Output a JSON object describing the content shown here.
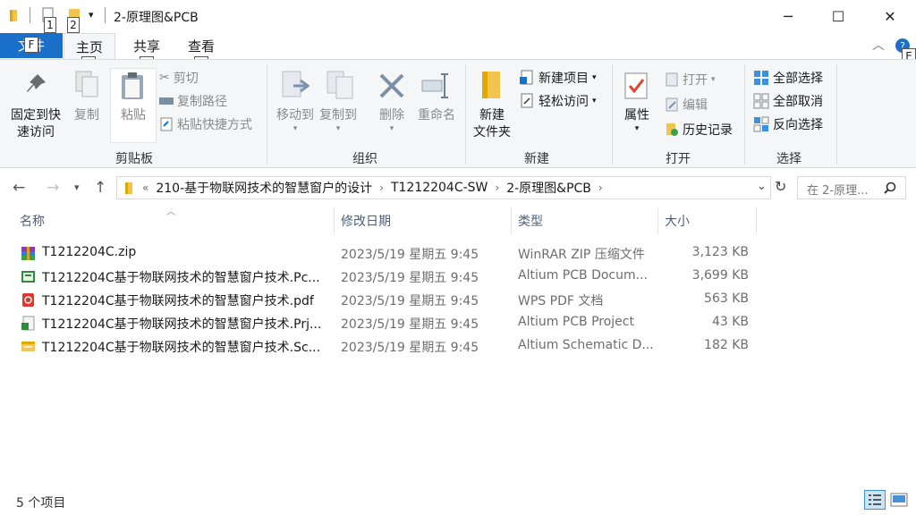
{
  "window": {
    "title": "2-原理图&PCB",
    "qat_badges": [
      "1",
      "2"
    ],
    "controls": {
      "minimize": "─",
      "maximize": "☐",
      "close": "✕"
    }
  },
  "ribbon_tabs": {
    "file": "文件",
    "file_key": "F",
    "home": "主页",
    "home_key": "H",
    "share": "共享",
    "share_key": "S",
    "view": "查看",
    "view_key": "V",
    "help_key": "E"
  },
  "clipboard": {
    "label": "剪贴板",
    "pin": "固定到快速访问",
    "pin_line1": "固定到快",
    "pin_line2": "速访问",
    "copy": "复制",
    "paste": "粘贴",
    "cut": "剪切",
    "copy_path": "复制路径",
    "paste_shortcut": "粘贴快捷方式"
  },
  "organize": {
    "label": "组织",
    "move_to": "移动到",
    "copy_to": "复制到",
    "delete": "删除",
    "rename": "重命名"
  },
  "new": {
    "label": "新建",
    "new_item": "新建项目",
    "easy_access": "轻松访问",
    "new_folder_line1": "新建",
    "new_folder_line2": "文件夹"
  },
  "open": {
    "label": "打开",
    "properties": "属性",
    "open": "打开",
    "edit": "编辑",
    "history": "历史记录"
  },
  "select": {
    "label": "选择",
    "select_all": "全部选择",
    "select_none": "全部取消",
    "invert": "反向选择"
  },
  "address": {
    "overflow": "«",
    "crumbs": [
      "210-基于物联网技术的智慧窗户的设计",
      "T1212204C-SW",
      "2-原理图&PCB"
    ],
    "search_placeholder": "在 2-原理..."
  },
  "columns": {
    "name": "名称",
    "date": "修改日期",
    "type": "类型",
    "size": "大小"
  },
  "files": [
    {
      "icon": "winrar-zip-icon",
      "name": "T1212204C.zip",
      "date": "2023/5/19 星期五 9:45",
      "type": "WinRAR ZIP 压缩文件",
      "size": "3,123 KB"
    },
    {
      "icon": "altium-pcb-icon",
      "name": "T1212204C基于物联网技术的智慧窗户技术.Pc...",
      "date": "2023/5/19 星期五 9:45",
      "type": "Altium PCB Docum...",
      "size": "3,699 KB"
    },
    {
      "icon": "pdf-icon",
      "name": "T1212204C基于物联网技术的智慧窗户技术.pdf",
      "date": "2023/5/19 星期五 9:45",
      "type": "WPS PDF 文档",
      "size": "563 KB"
    },
    {
      "icon": "altium-project-icon",
      "name": "T1212204C基于物联网技术的智慧窗户技术.Prj...",
      "date": "2023/5/19 星期五 9:45",
      "type": "Altium PCB Project",
      "size": "43 KB"
    },
    {
      "icon": "altium-schematic-icon",
      "name": "T1212204C基于物联网技术的智慧窗户技术.Sc...",
      "date": "2023/5/19 星期五 9:45",
      "type": "Altium Schematic D...",
      "size": "182 KB"
    }
  ],
  "status": {
    "item_count": "5 个项目"
  },
  "colors": {
    "accent": "#1a6fc9",
    "ribbon_bg": "#f5f6f7",
    "folder": "#f3c44d"
  }
}
